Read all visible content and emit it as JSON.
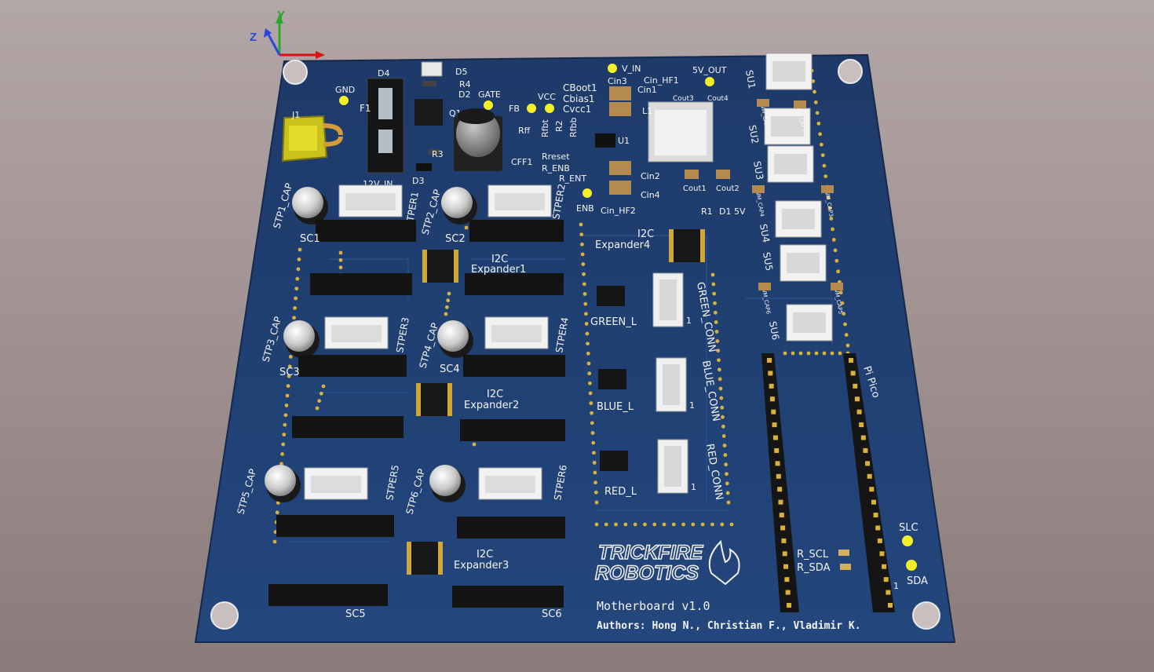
{
  "axes": {
    "x": "",
    "y": "Y",
    "z": "Z",
    "colors": {
      "x": "#e01010",
      "y": "#2aa82a",
      "z": "#2a46e0"
    }
  },
  "board": {
    "color": "#1f3d6e",
    "motherboard_label": "Motherboard v1.0",
    "authors_label": "Authors: Hong N., Christian F., Vladimir K.",
    "logo_line1": "TRICKFIRE",
    "logo_line2": "ROBOTICS",
    "pi_label": "Pi Pico"
  },
  "test_points": [
    "GND",
    "V_IN",
    "5V_OUT",
    "GATE",
    "FB",
    "VCC",
    "ENB",
    "SLC",
    "SDA"
  ],
  "power_section": {
    "labels": [
      "D4",
      "D5",
      "R4",
      "D2",
      "F1",
      "Q1",
      "R3",
      "D3",
      "12V_IN",
      "J1",
      "CBoot1",
      "Cbias1",
      "Cvcc1",
      "Cin3",
      "Cin1",
      "Cin_HF1",
      "Cout3",
      "Cout4",
      "L1",
      "U1",
      "Rff",
      "Rfbt",
      "R2",
      "Rfbb",
      "Rreset",
      "CFF1",
      "R_ENB",
      "R_ENT",
      "Cin2",
      "Cin4",
      "Cin_HF2",
      "Cout1",
      "Cout2",
      "R1",
      "D1",
      "5V"
    ]
  },
  "steppers": [
    {
      "cap": "STP1_CAP",
      "conn": "STPER1",
      "sc": "SC1"
    },
    {
      "cap": "STP2_CAP",
      "conn": "STPER2",
      "sc": "SC2"
    },
    {
      "cap": "STP3_CAP",
      "conn": "STPER3",
      "sc": "SC3"
    },
    {
      "cap": "STP4_CAP",
      "conn": "STPER4",
      "sc": "SC4"
    },
    {
      "cap": "STP5_CAP",
      "conn": "STPER5",
      "sc": "SC5"
    },
    {
      "cap": "STP6_CAP",
      "conn": "STPER6",
      "sc": "SC6"
    }
  ],
  "expanders": [
    "I2C Expander1",
    "I2C Expander2",
    "I2C Expander3",
    "I2C Expander4"
  ],
  "led_drivers": [
    {
      "driver": "GREEN_L",
      "conn": "GREEN_CONN"
    },
    {
      "driver": "BLUE_L",
      "conn": "BLUE_CONN"
    },
    {
      "driver": "RED_L",
      "conn": "RED_CONN"
    }
  ],
  "servos": [
    "SU1",
    "SU2",
    "SU3",
    "SU4",
    "SU5",
    "SU6"
  ],
  "servo_caps": [
    "PWM_CAP1",
    "PWM_CAP2",
    "PWM_CAP3",
    "PWM_CAP4",
    "PWM_CAP5",
    "PWM_CAP6"
  ],
  "i2c_pullups": [
    "R_SCL",
    "R_SDA"
  ],
  "pin_one": "1"
}
